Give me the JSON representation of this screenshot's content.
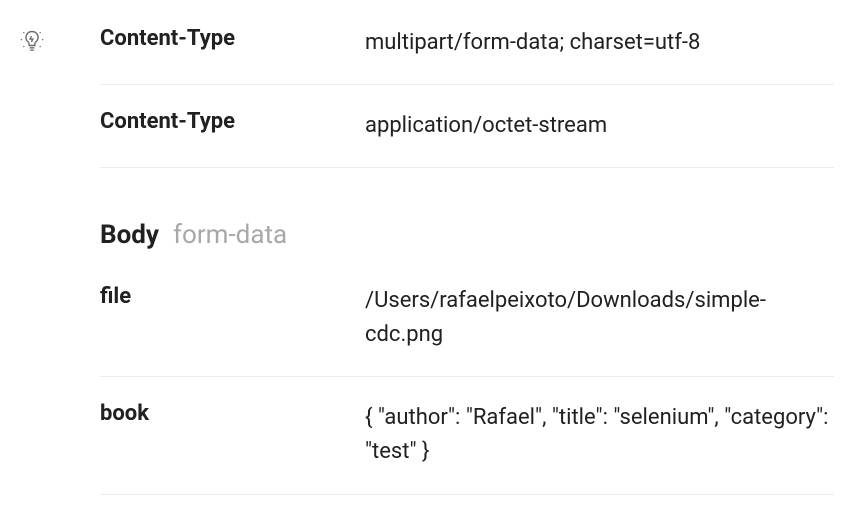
{
  "headers": [
    {
      "key": "Content-Type",
      "value": "multipart/form-data; charset=utf-8"
    },
    {
      "key": "Content-Type",
      "value": "application/octet-stream"
    }
  ],
  "body_section": {
    "title": "Body",
    "subtitle": "form-data",
    "rows": [
      {
        "key": "file",
        "value": "/Users/rafaelpeixoto/Downloads/simple-cdc.png"
      },
      {
        "key": "book",
        "value": "{ \"author\": \"Rafael\", \"title\": \"selenium\", \"category\": \"test\" }"
      }
    ]
  }
}
